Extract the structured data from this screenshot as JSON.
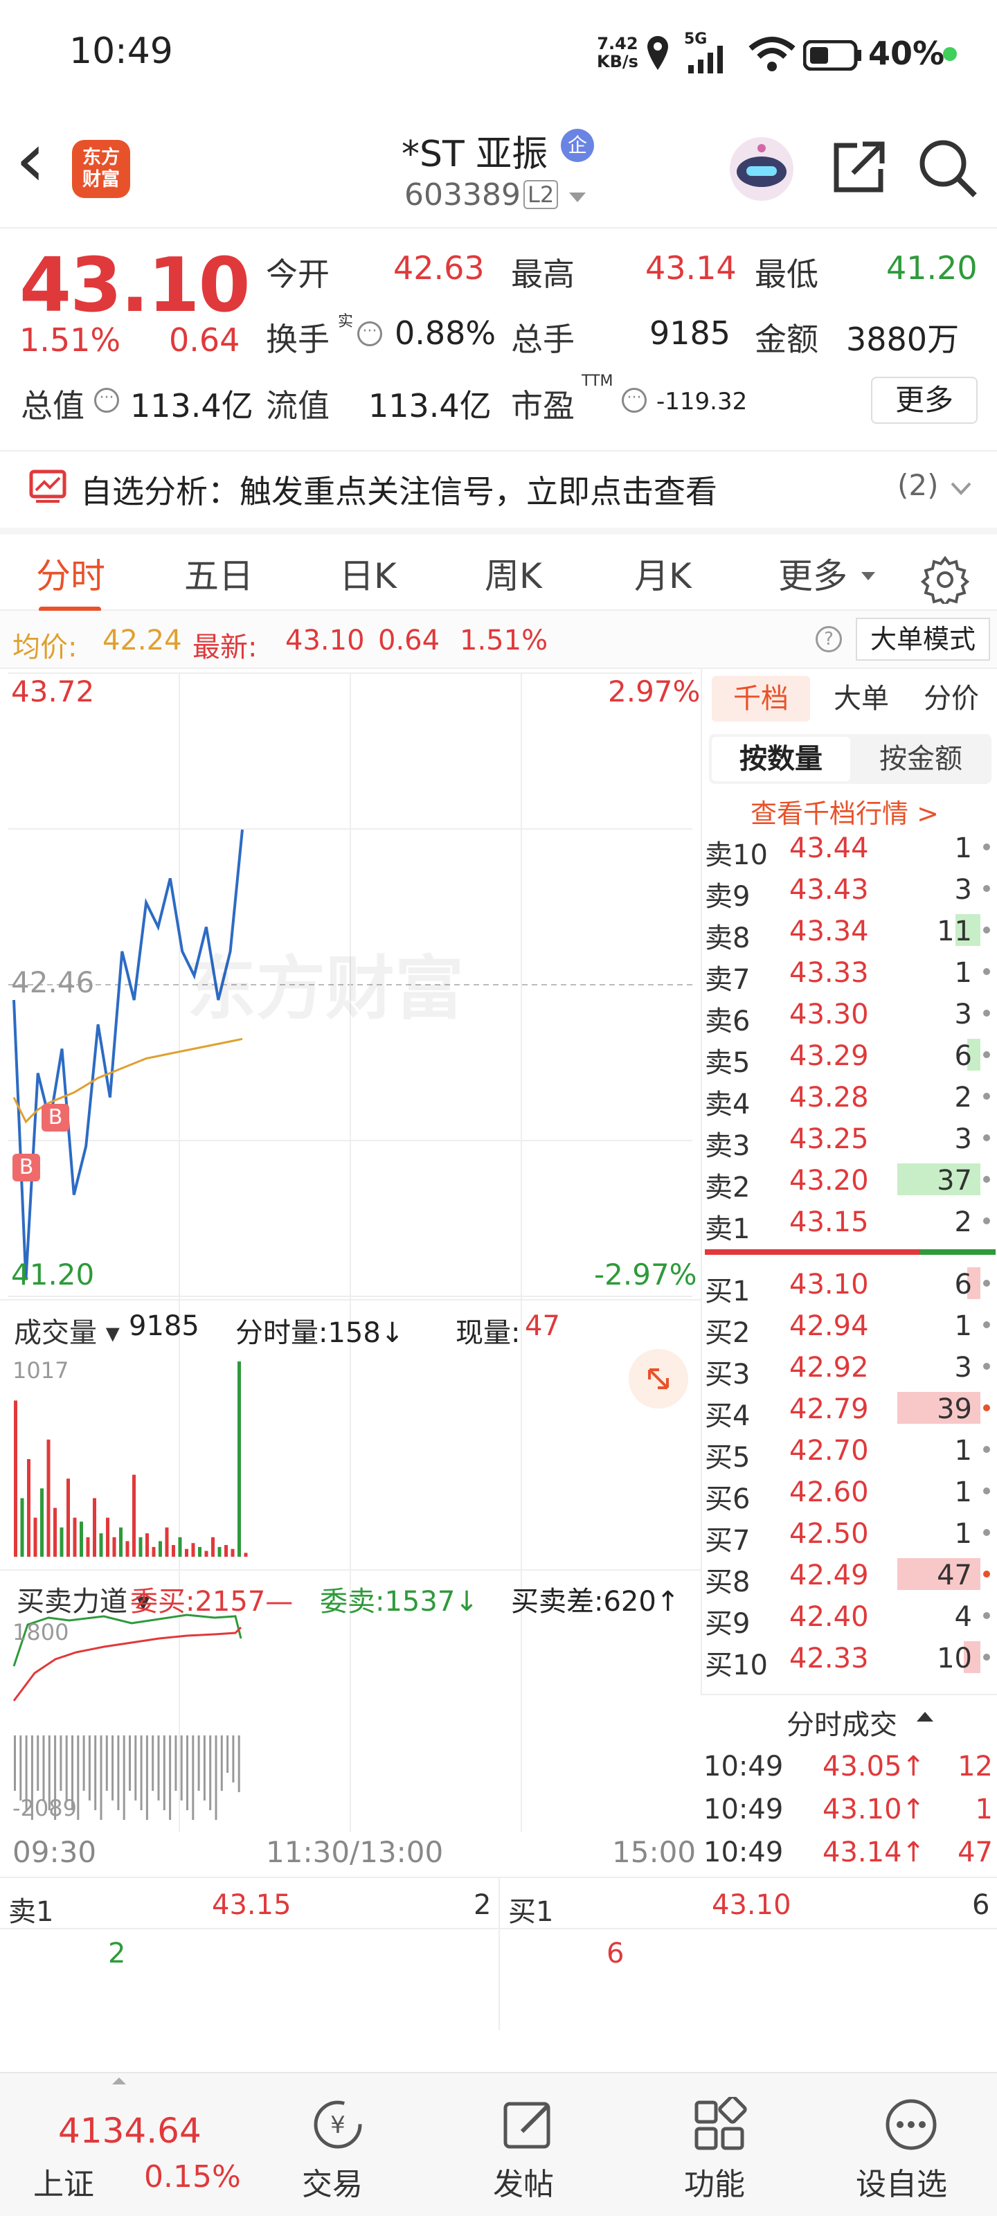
{
  "status": {
    "time": "10:49",
    "net_speed": "7.42",
    "net_unit": "KB/s",
    "signal": "5G",
    "battery": "40%"
  },
  "header": {
    "back": "‹",
    "logo_line1": "东方",
    "logo_line2": "财富",
    "stock_name": "*ST 亚振",
    "enterprise_badge": "企",
    "code": "603389",
    "level": "L2"
  },
  "quote": {
    "price": "43.10",
    "change_pct": "1.51%",
    "change": "0.64",
    "open_label": "今开",
    "open": "42.63",
    "high_label": "最高",
    "high": "43.14",
    "low_label": "最低",
    "low": "41.20",
    "turnover_label": "换手",
    "turnover_sup": "实",
    "turnover": "0.88%",
    "volume_label": "总手",
    "volume": "9185",
    "amount_label": "金额",
    "amount": "3880万",
    "mktcap_label": "总值",
    "mktcap": "113.4亿",
    "float_label": "流值",
    "float_cap": "113.4亿",
    "pe_label": "市盈",
    "pe_sup": "TTM",
    "pe": "-119.32",
    "more": "更多"
  },
  "analysis": {
    "text": "自选分析：触发重点关注信号，立即点击查看",
    "count": "(2)"
  },
  "tabs": [
    "分时",
    "五日",
    "日K",
    "周K",
    "月K",
    "更多"
  ],
  "infobar": {
    "avg_label": "均价:",
    "avg": "42.24",
    "latest_label": "最新:",
    "latest": "43.10",
    "chg": "0.64",
    "pct": "1.51%",
    "mode": "大单模式"
  },
  "chart": {
    "y_top": "43.72",
    "y_bottom": "41.20",
    "y_mid": "42.46",
    "pct_top": "2.97%",
    "pct_bottom": "-2.97%",
    "watermark": "东方财富",
    "marker": "B",
    "vol_label": "成交量",
    "vol_total": "9185",
    "vol_minute": "分时量:158↓",
    "vol_now_label": "现量:",
    "vol_now": "47",
    "vol_max": "1017",
    "force_label": "买卖力道",
    "force_buy": "委买:2157—",
    "force_sell": "委卖:1537↓",
    "force_diff": "买卖差:620↑",
    "force_top": "1800",
    "force_bottom": "-2089",
    "time_start": "09:30",
    "time_mid": "11:30/13:00",
    "time_end": "15:00"
  },
  "chart_data": {
    "type": "line",
    "title": "",
    "x_labels": [
      "09:30",
      "11:30/13:00",
      "15:00"
    ],
    "ylim": [
      41.2,
      43.72
    ],
    "prev_close": 42.46,
    "series": [
      {
        "name": "最新",
        "values": [
          42.4,
          41.25,
          42.1,
          41.9,
          42.2,
          41.6,
          41.8,
          42.3,
          42.0,
          42.6,
          42.4,
          42.8,
          42.7,
          42.9,
          42.6,
          42.5,
          42.7,
          42.4,
          42.6,
          43.1
        ]
      },
      {
        "name": "均价",
        "values": [
          42.0,
          41.9,
          41.95,
          41.98,
          42.0,
          42.02,
          42.05,
          42.08,
          42.1,
          42.12,
          42.14,
          42.16,
          42.17,
          42.18,
          42.19,
          42.2,
          42.21,
          42.22,
          42.23,
          42.24
        ]
      }
    ],
    "volume": {
      "max": 1017,
      "total": 9185,
      "last": 47
    }
  },
  "orderbook": {
    "tabs": [
      "千档",
      "大单",
      "分价"
    ],
    "subtabs": [
      "按数量",
      "按金额"
    ],
    "link": "查看千档行情 >",
    "asks": [
      {
        "label": "卖10",
        "price": "43.44",
        "vol": "1",
        "bar": 0
      },
      {
        "label": "卖9",
        "price": "43.43",
        "vol": "3",
        "bar": 0
      },
      {
        "label": "卖8",
        "price": "43.34",
        "vol": "11",
        "bar": 0.3
      },
      {
        "label": "卖7",
        "price": "43.33",
        "vol": "1",
        "bar": 0
      },
      {
        "label": "卖6",
        "price": "43.30",
        "vol": "3",
        "bar": 0
      },
      {
        "label": "卖5",
        "price": "43.29",
        "vol": "6",
        "bar": 0.16
      },
      {
        "label": "卖4",
        "price": "43.28",
        "vol": "2",
        "bar": 0
      },
      {
        "label": "卖3",
        "price": "43.25",
        "vol": "3",
        "bar": 0
      },
      {
        "label": "卖2",
        "price": "43.20",
        "vol": "37",
        "bar": 1
      },
      {
        "label": "卖1",
        "price": "43.15",
        "vol": "2",
        "bar": 0
      }
    ],
    "bids": [
      {
        "label": "买1",
        "price": "43.10",
        "vol": "6",
        "bar": 0.16
      },
      {
        "label": "买2",
        "price": "42.94",
        "vol": "1",
        "bar": 0
      },
      {
        "label": "买3",
        "price": "42.92",
        "vol": "3",
        "bar": 0
      },
      {
        "label": "买4",
        "price": "42.79",
        "vol": "39",
        "bar": 1
      },
      {
        "label": "买5",
        "price": "42.70",
        "vol": "1",
        "bar": 0
      },
      {
        "label": "买6",
        "price": "42.60",
        "vol": "1",
        "bar": 0
      },
      {
        "label": "买7",
        "price": "42.50",
        "vol": "1",
        "bar": 0
      },
      {
        "label": "买8",
        "price": "42.49",
        "vol": "47",
        "bar": 1
      },
      {
        "label": "买9",
        "price": "42.40",
        "vol": "4",
        "bar": 0
      },
      {
        "label": "买10",
        "price": "42.33",
        "vol": "10",
        "bar": 0.2
      }
    ],
    "trades_title": "分时成交",
    "trades": [
      {
        "time": "10:49",
        "price": "43.05↑",
        "vol": "12"
      },
      {
        "time": "10:49",
        "price": "43.10↑",
        "vol": "1"
      },
      {
        "time": "10:49",
        "price": "43.14↑",
        "vol": "47"
      }
    ]
  },
  "summary": {
    "sell_label": "卖1",
    "sell_price": "43.15",
    "sell_vol": "2",
    "sell_sub": "2",
    "buy_label": "买1",
    "buy_price": "43.10",
    "buy_vol": "6",
    "buy_sub": "6"
  },
  "bottom": {
    "index_value": "4134.64",
    "index_name": "上证",
    "index_pct": "0.15%",
    "items": [
      "交易",
      "发帖",
      "功能",
      "设自选"
    ]
  },
  "colors": {
    "up": "#e0393b",
    "down": "#2e9a3a",
    "accent": "#e8522a",
    "line": "#2d6bc4",
    "avg": "#e0a030"
  }
}
